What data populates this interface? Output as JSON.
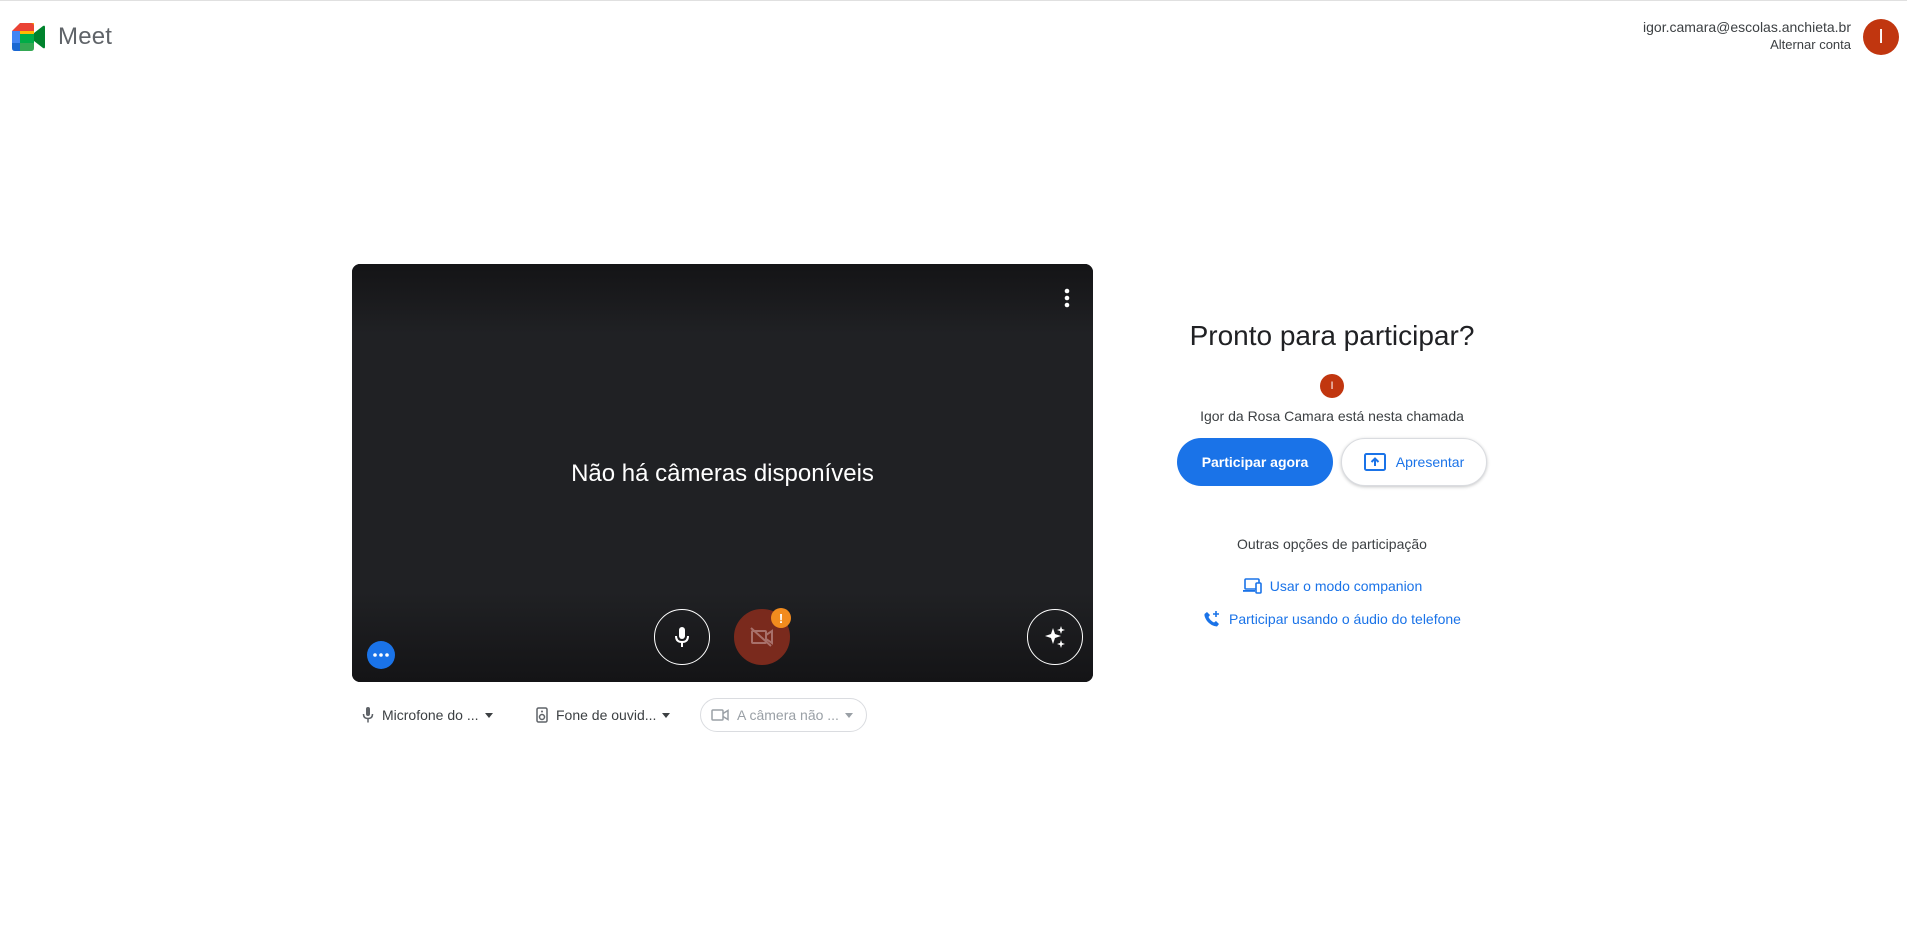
{
  "header": {
    "app_name": "Meet",
    "account_email": "igor.camara@escolas.anchieta.br",
    "switch_account": "Alternar conta",
    "avatar_initial": "I",
    "avatar_color": "#c1360f"
  },
  "preview": {
    "message": "Não há câmeras disponíveis",
    "camera_warning": "!",
    "icons": [
      "more-vert-icon",
      "mic-icon",
      "camera-off-icon",
      "sparkle-effects-icon",
      "more-horiz-icon"
    ]
  },
  "devices": {
    "microphone": "Microfone do ...",
    "speaker": "Fone de ouvid...",
    "camera": "A câmera não ..."
  },
  "join_panel": {
    "title": "Pronto para participar?",
    "participant_initial": "I",
    "in_call_text": "Igor da Rosa Camara está nesta chamada",
    "join_button": "Participar agora",
    "present_button": "Apresentar",
    "other_options_title": "Outras opções de participação",
    "companion_link": "Usar o modo companion",
    "phone_link": "Participar usando o áudio do telefone"
  },
  "colors": {
    "primary": "#1a73e8",
    "preview_bg": "#202124",
    "camera_off_bg": "#7a2a1d",
    "warning": "#f28b1e"
  }
}
